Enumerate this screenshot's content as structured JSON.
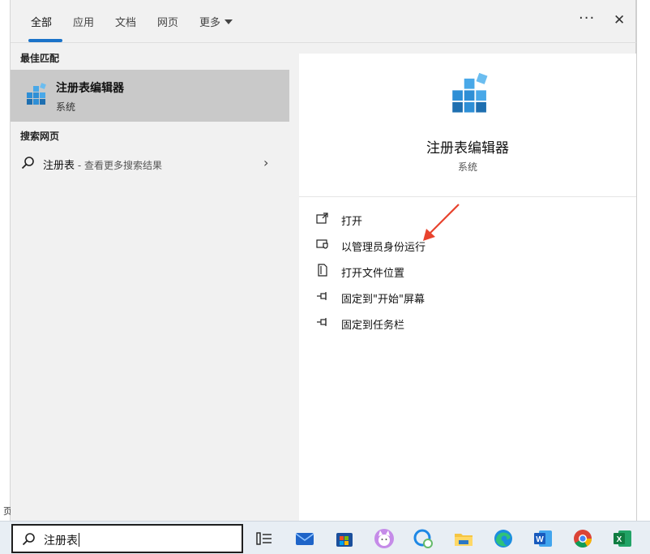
{
  "background": {
    "stub_text": "页"
  },
  "tabs": [
    {
      "label": "全部",
      "active": true
    },
    {
      "label": "应用"
    },
    {
      "label": "文档"
    },
    {
      "label": "网页"
    },
    {
      "label": "更多"
    }
  ],
  "topbar": {
    "more_glyph": "···",
    "close_glyph": "✕"
  },
  "best_match": {
    "header": "最佳匹配",
    "title": "注册表编辑器",
    "subtitle": "系统",
    "icon": "registry-editor-icon"
  },
  "web_search": {
    "header": "搜索网页",
    "query": "注册表",
    "suffix": " - 查看更多搜索结果",
    "chevron": "›"
  },
  "detail": {
    "title": "注册表编辑器",
    "subtitle": "系统",
    "actions": [
      {
        "label": "打开",
        "icon": "open-icon"
      },
      {
        "label": "以管理员身份运行",
        "icon": "shield-icon"
      },
      {
        "label": "打开文件位置",
        "icon": "file-location-icon"
      },
      {
        "label": "固定到\"开始\"屏幕",
        "icon": "pin-icon"
      },
      {
        "label": "固定到任务栏",
        "icon": "pin-icon"
      }
    ]
  },
  "search": {
    "value": "注册表"
  },
  "taskbar_icons": [
    "task-view-icon",
    "mail-icon",
    "store-icon",
    "cat-app-icon",
    "chat-icon",
    "file-explorer-icon",
    "edge-icon",
    "word-icon",
    "chrome-icon",
    "excel-icon"
  ],
  "colors": {
    "accent": "#1a73c9",
    "selected": "#c9c9c9",
    "panel": "#f1f1f1",
    "arrow": "#e8432e"
  }
}
